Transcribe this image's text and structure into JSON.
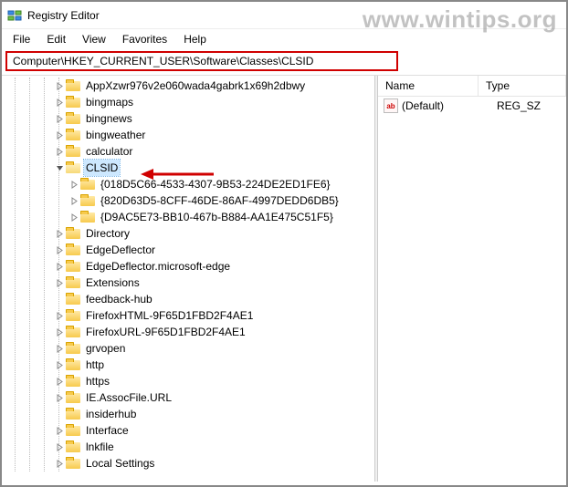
{
  "window": {
    "title": "Registry Editor"
  },
  "menu": {
    "file": "File",
    "edit": "Edit",
    "view": "View",
    "favorites": "Favorites",
    "help": "Help"
  },
  "address": "Computer\\HKEY_CURRENT_USER\\Software\\Classes\\CLSID",
  "columns": {
    "name": "Name",
    "type": "Type"
  },
  "value_row": {
    "name": "(Default)",
    "type": "REG_SZ"
  },
  "tree": {
    "items": [
      {
        "label": "AppXzwr976v2e060wada4gabrk1x69h2dbwy",
        "depth": 4,
        "expandable": true
      },
      {
        "label": "bingmaps",
        "depth": 4,
        "expandable": true
      },
      {
        "label": "bingnews",
        "depth": 4,
        "expandable": true
      },
      {
        "label": "bingweather",
        "depth": 4,
        "expandable": true
      },
      {
        "label": "calculator",
        "depth": 4,
        "expandable": true
      },
      {
        "label": "CLSID",
        "depth": 4,
        "expandable": true,
        "expanded": true,
        "selected": true,
        "arrow": true
      },
      {
        "label": "{018D5C66-4533-4307-9B53-224DE2ED1FE6}",
        "depth": 5,
        "expandable": true
      },
      {
        "label": "{820D63D5-8CFF-46DE-86AF-4997DEDD6DB5}",
        "depth": 5,
        "expandable": true
      },
      {
        "label": "{D9AC5E73-BB10-467b-B884-AA1E475C51F5}",
        "depth": 5,
        "expandable": true
      },
      {
        "label": "Directory",
        "depth": 4,
        "expandable": true
      },
      {
        "label": "EdgeDeflector",
        "depth": 4,
        "expandable": true
      },
      {
        "label": "EdgeDeflector.microsoft-edge",
        "depth": 4,
        "expandable": true
      },
      {
        "label": "Extensions",
        "depth": 4,
        "expandable": true
      },
      {
        "label": "feedback-hub",
        "depth": 4,
        "expandable": false
      },
      {
        "label": "FirefoxHTML-9F65D1FBD2F4AE1",
        "depth": 4,
        "expandable": true
      },
      {
        "label": "FirefoxURL-9F65D1FBD2F4AE1",
        "depth": 4,
        "expandable": true
      },
      {
        "label": "grvopen",
        "depth": 4,
        "expandable": true
      },
      {
        "label": "http",
        "depth": 4,
        "expandable": true
      },
      {
        "label": "https",
        "depth": 4,
        "expandable": true
      },
      {
        "label": "IE.AssocFile.URL",
        "depth": 4,
        "expandable": true
      },
      {
        "label": "insiderhub",
        "depth": 4,
        "expandable": false
      },
      {
        "label": "Interface",
        "depth": 4,
        "expandable": true
      },
      {
        "label": "lnkfile",
        "depth": 4,
        "expandable": true
      },
      {
        "label": "Local Settings",
        "depth": 4,
        "expandable": true
      }
    ]
  },
  "watermark": "www.wintips.org"
}
